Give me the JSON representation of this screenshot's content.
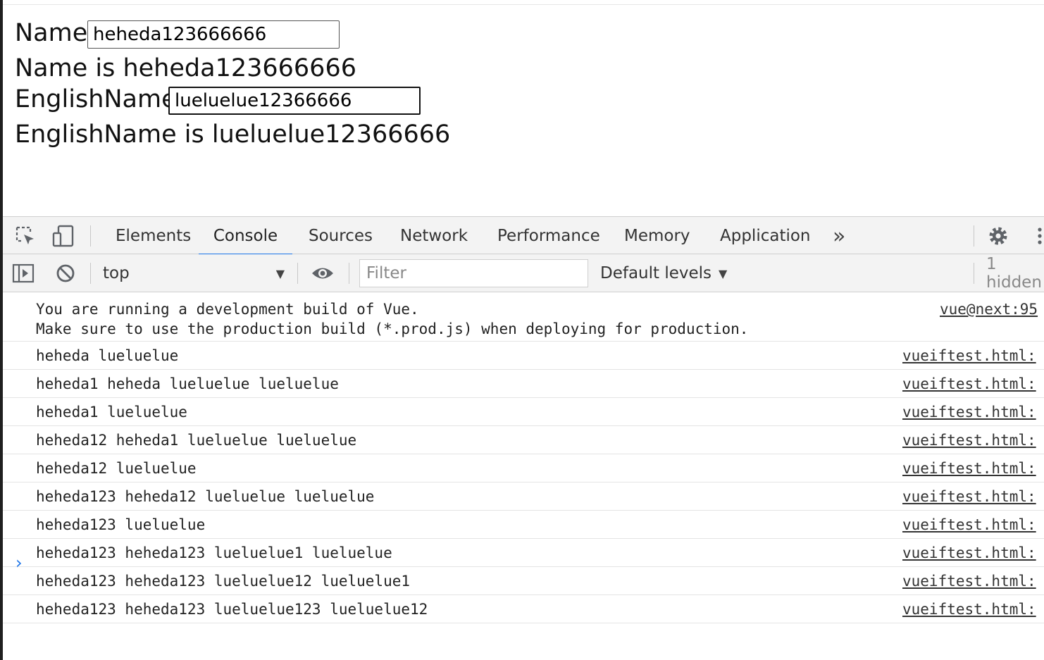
{
  "page": {
    "name_label": "Name:",
    "name_value": "heheda123666666",
    "name_display": "Name is heheda123666666",
    "english_label": "EnglishName:",
    "english_value": "lueluelue12366666",
    "english_display": "EnglishName is lueluelue12366666"
  },
  "devtools": {
    "tabs": [
      "Elements",
      "Console",
      "Sources",
      "Network",
      "Performance",
      "Memory",
      "Application"
    ],
    "active_tab": "Console",
    "more_tabs_glyph": "»",
    "icons": {
      "inspect": "inspect-element-icon",
      "device": "device-toolbar-icon",
      "settings": "gear-icon",
      "menu": "kebab-menu-icon",
      "sidebar": "console-sidebar-icon",
      "clear": "clear-console-icon",
      "eye": "live-expression-icon"
    },
    "accent_color": "#1a73e8",
    "toolbar": {
      "context": "top",
      "filter_placeholder": "Filter",
      "levels": "Default levels",
      "hidden": "1 hidden"
    },
    "messages": [
      {
        "text": "You are running a development build of Vue.\nMake sure to use the production build (*.prod.js) when deploying for production.",
        "source": "vue@next:95"
      },
      {
        "text": "heheda lueluelue",
        "source": "vueiftest.html:"
      },
      {
        "text": "heheda1 heheda lueluelue lueluelue",
        "source": "vueiftest.html:"
      },
      {
        "text": "heheda1 lueluelue",
        "source": "vueiftest.html:"
      },
      {
        "text": "heheda12 heheda1 lueluelue lueluelue",
        "source": "vueiftest.html:"
      },
      {
        "text": "heheda12 lueluelue",
        "source": "vueiftest.html:"
      },
      {
        "text": "heheda123 heheda12 lueluelue lueluelue",
        "source": "vueiftest.html:"
      },
      {
        "text": "heheda123 lueluelue",
        "source": "vueiftest.html:"
      },
      {
        "text": "heheda123 heheda123 lueluelue1 lueluelue",
        "source": "vueiftest.html:"
      },
      {
        "text": "heheda123 heheda123 lueluelue12 lueluelue1",
        "source": "vueiftest.html:"
      },
      {
        "text": "heheda123 heheda123 lueluelue123 lueluelue12",
        "source": "vueiftest.html:"
      }
    ],
    "prompt_glyph": "›"
  }
}
